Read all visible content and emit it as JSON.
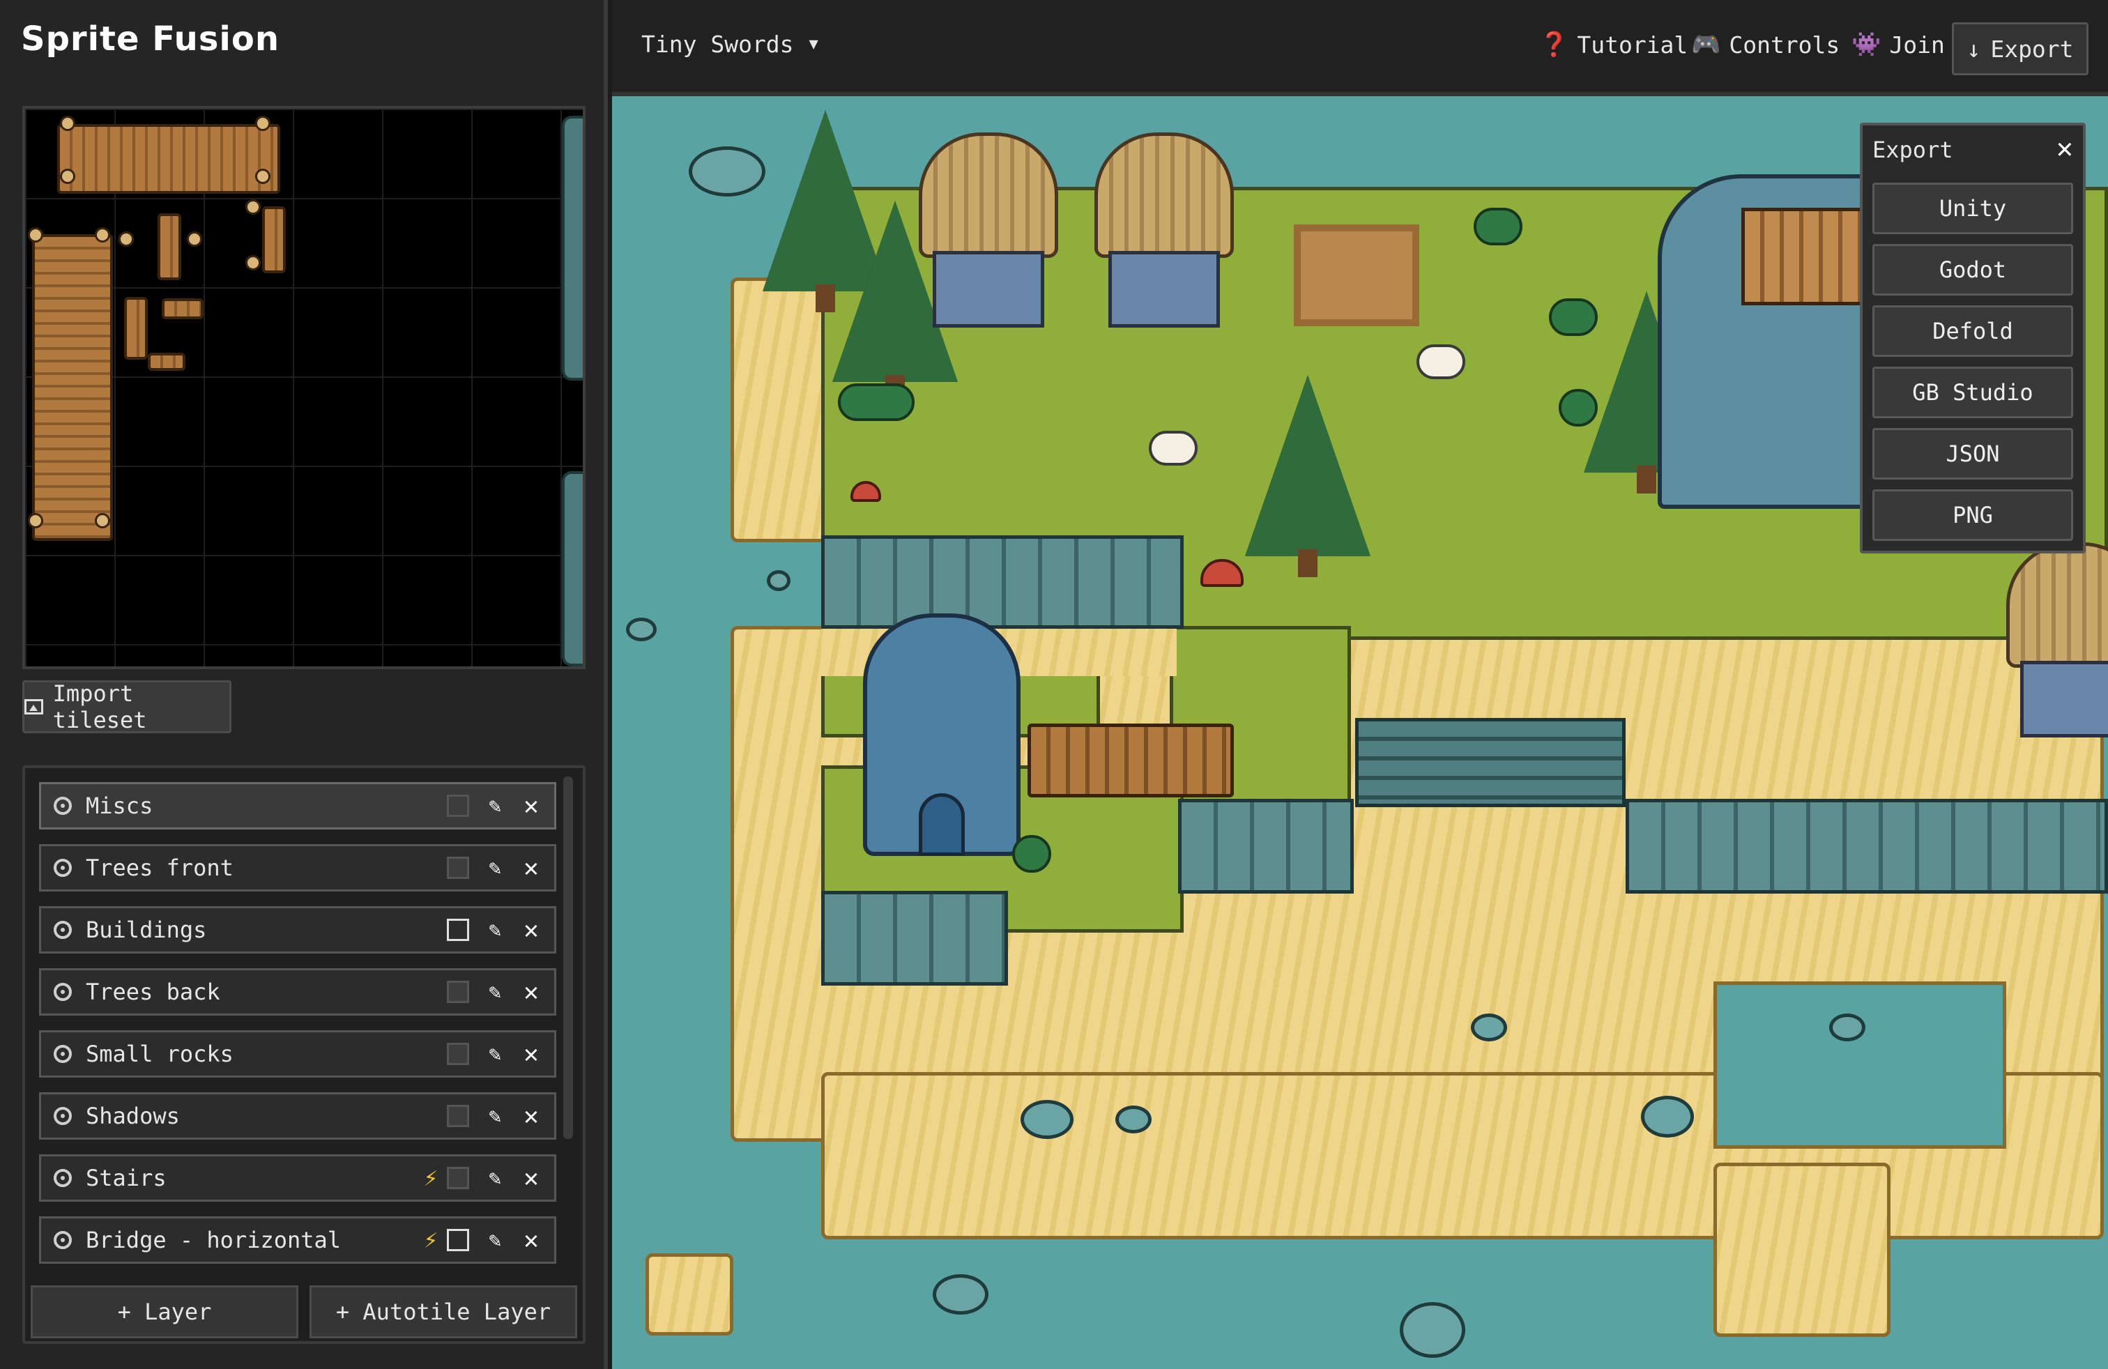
{
  "app": {
    "title": "Sprite Fusion"
  },
  "tileset": {
    "import_label": "Import tileset",
    "import_icon": "image-icon"
  },
  "layers": {
    "items": [
      {
        "name": "Miscs",
        "autotile": false,
        "opacity_active": false,
        "selected": true
      },
      {
        "name": "Trees front",
        "autotile": false,
        "opacity_active": false,
        "selected": false
      },
      {
        "name": "Buildings",
        "autotile": false,
        "opacity_active": true,
        "selected": false
      },
      {
        "name": "Trees back",
        "autotile": false,
        "opacity_active": false,
        "selected": false
      },
      {
        "name": "Small rocks",
        "autotile": false,
        "opacity_active": false,
        "selected": false
      },
      {
        "name": "Shadows",
        "autotile": false,
        "opacity_active": false,
        "selected": false
      },
      {
        "name": "Stairs",
        "autotile": true,
        "opacity_active": false,
        "selected": false
      },
      {
        "name": "Bridge - horizontal",
        "autotile": true,
        "opacity_active": true,
        "selected": false
      }
    ],
    "add_layer_label": "+ Layer",
    "add_autotile_label": "+ Autotile Layer"
  },
  "topbar": {
    "project": "Tiny Swords",
    "tutorial": "Tutorial",
    "controls": "Controls",
    "join": "Join",
    "export": "Export"
  },
  "export_panel": {
    "title": "Export",
    "options": [
      "Unity",
      "Godot",
      "Defold",
      "GB Studio",
      "JSON",
      "PNG"
    ]
  },
  "colors": {
    "water": "#5aa3a3",
    "grass": "#8fae3a",
    "sand": "#eed58a",
    "accent_bolt": "#f2c12e"
  }
}
